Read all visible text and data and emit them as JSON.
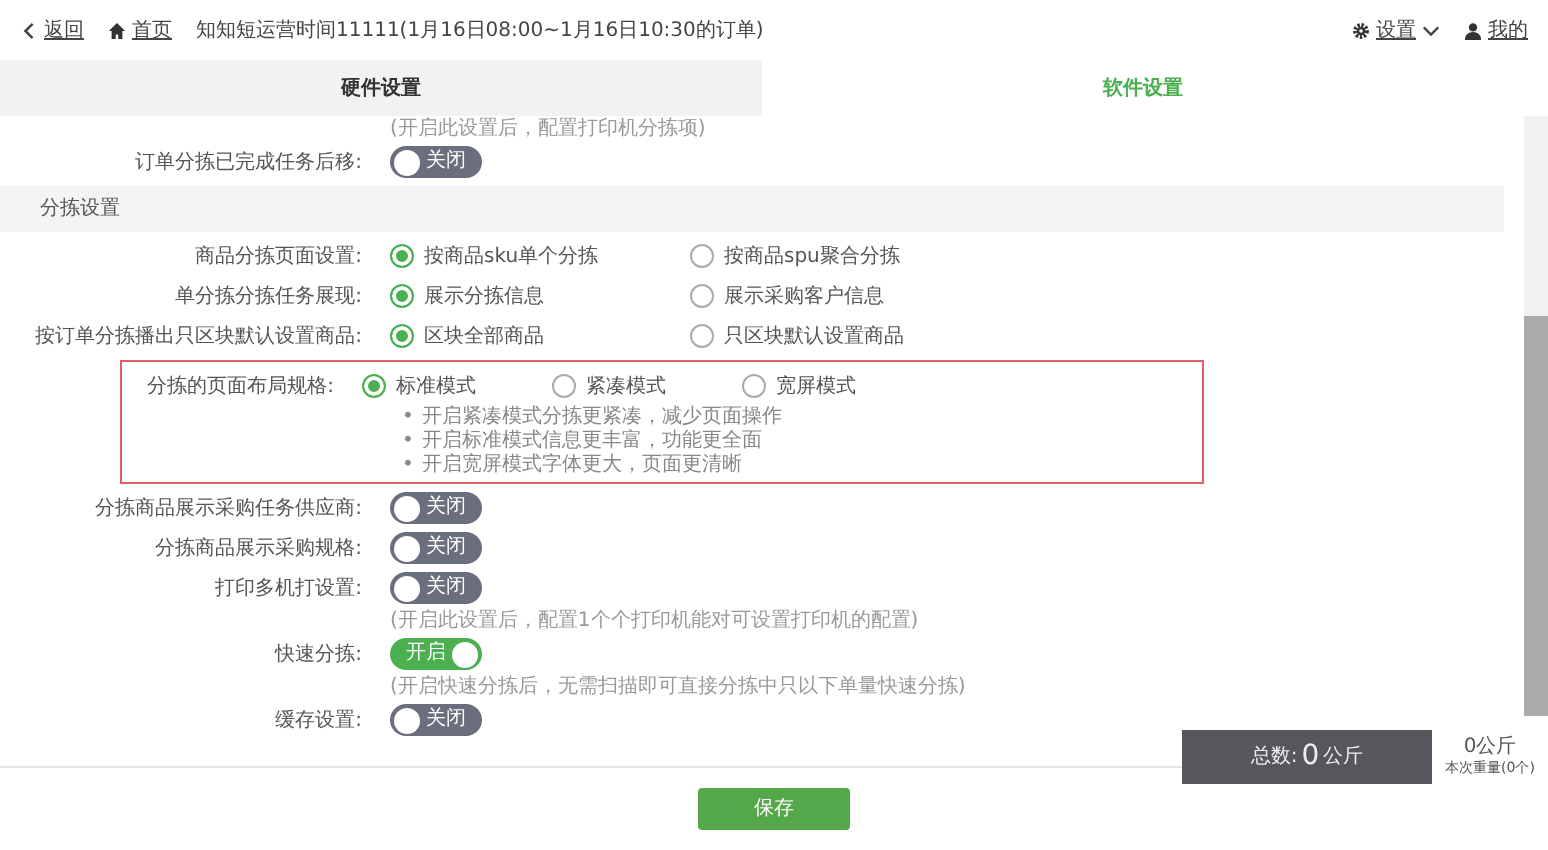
{
  "header": {
    "back": "返回",
    "home": "首页",
    "title": "知知短运营时间11111(1月16日08:00~1月16日10:30的订单)",
    "settings": "设置",
    "user": "我的"
  },
  "tabs": [
    {
      "label": "硬件设置",
      "selected": false
    },
    {
      "label": "软件设置",
      "selected": true
    }
  ],
  "rows": [
    {
      "kind": "note",
      "text": "(开启此设置后，配置打印机分拣项)"
    },
    {
      "kind": "toggle",
      "label": "订单分拣已完成任务后移:",
      "on": false,
      "state_text": "关闭"
    },
    {
      "kind": "section",
      "text": "分拣设置"
    },
    {
      "kind": "radio",
      "label": "商品分拣页面设置:",
      "highlighted": false,
      "options": [
        {
          "label": "按商品sku单个分拣",
          "selected": true
        },
        {
          "label": "按商品spu聚合分拣",
          "selected": false
        }
      ]
    },
    {
      "kind": "radio",
      "label": "单分拣分拣任务展现:",
      "highlighted": false,
      "options": [
        {
          "label": "展示分拣信息",
          "selected": true
        },
        {
          "label": "展示采购客户信息",
          "selected": false
        }
      ]
    },
    {
      "kind": "radio",
      "label": "按订单分拣播出只区块默认设置商品:",
      "highlighted": false,
      "options": [
        {
          "label": "区块全部商品",
          "selected": true
        },
        {
          "label": "只区块默认设置商品",
          "selected": false
        }
      ]
    },
    {
      "kind": "radio",
      "label": "分拣的页面布局规格:",
      "highlighted": true,
      "tip_bullet": "•",
      "options": [
        {
          "label": "标准模式",
          "selected": true
        },
        {
          "label": "紧凑模式",
          "selected": false
        },
        {
          "label": "宽屏模式",
          "selected": false
        }
      ],
      "tips": [
        "开启紧凑模式分拣更紧凑，减少页面操作",
        "开启标准模式信息更丰富，功能更全面",
        "开启宽屏模式字体更大，页面更清晰"
      ]
    },
    {
      "kind": "toggle",
      "label": "分拣商品展示采购任务供应商:",
      "on": false,
      "state_text": "关闭"
    },
    {
      "kind": "toggle",
      "label": "分拣商品展示采购规格:",
      "on": false,
      "state_text": "关闭"
    },
    {
      "kind": "toggle",
      "label": "打印多机打设置:",
      "on": false,
      "state_text": "关闭"
    },
    {
      "kind": "note",
      "text": "(开启此设置后，配置1个个打印机能对可设置打印机的配置)"
    },
    {
      "kind": "toggle",
      "label": "快速分拣:",
      "on": true,
      "state_text": "开启"
    },
    {
      "kind": "note",
      "text": "(开启快速分拣后，无需扫描即可直接分拣中只以下单量快速分拣)"
    },
    {
      "kind": "toggle",
      "label": "缓存设置:",
      "on": false,
      "state_text": "关闭"
    }
  ],
  "save_button": "保存",
  "weight_panel": {
    "total_label": "总数:",
    "total_value": "0",
    "total_unit": "公斤",
    "current": "0公斤",
    "current_note": "本次重量(0个)"
  }
}
